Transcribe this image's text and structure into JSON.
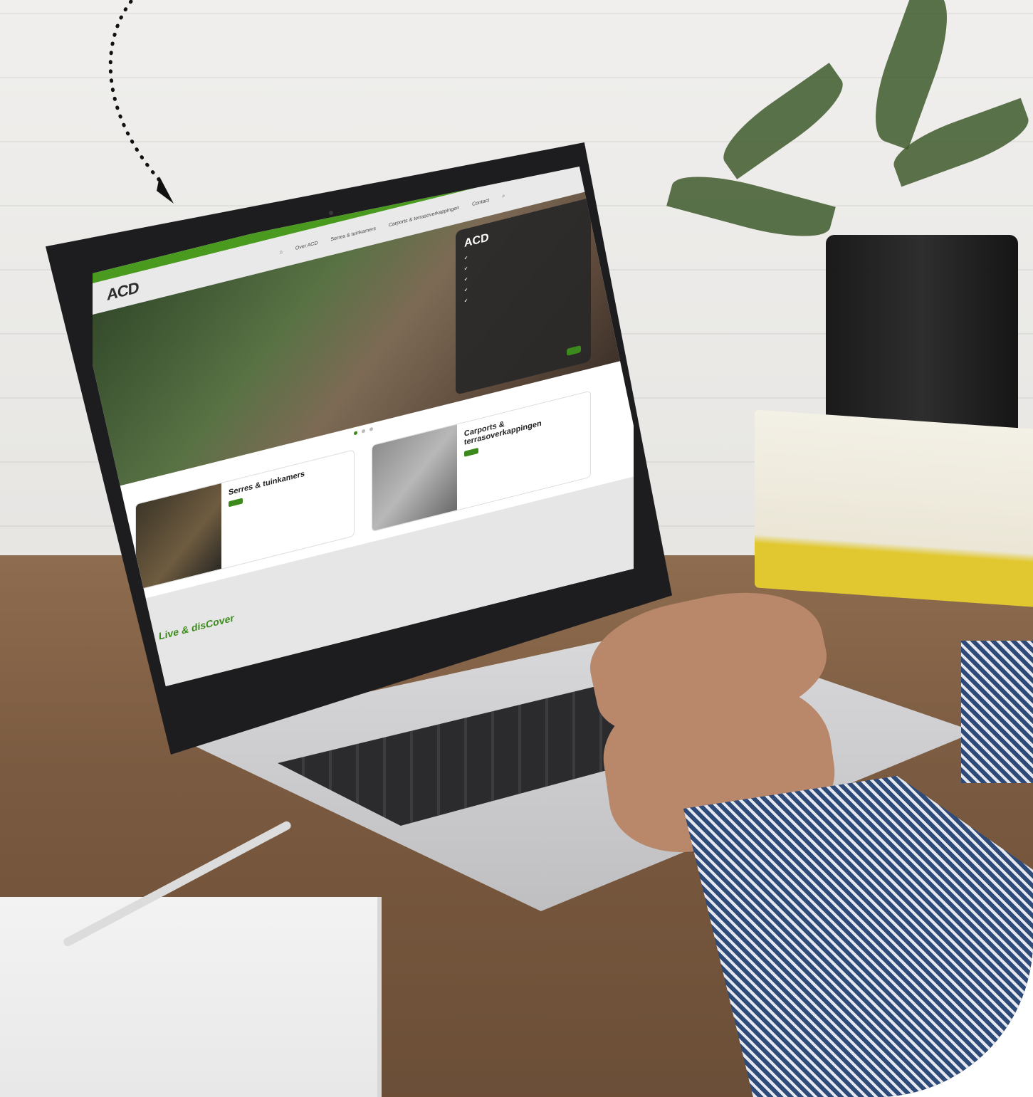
{
  "site": {
    "topbar_links": [
      "",
      ""
    ],
    "logo": "ACD",
    "nav_items": [
      "Over ACD",
      "Serres & tuinkamers",
      "Carports & terrasoverkappingen",
      "Contact"
    ],
    "hero_panel": {
      "logo": "ACD",
      "cta": ""
    },
    "cards": [
      {
        "title": "Serres & tuinkamers",
        "button": ""
      },
      {
        "title": "Carports & terrasoverkappingen",
        "button": ""
      }
    ],
    "tagline": "Grow, Live & disCover",
    "subline": "",
    "cookie": ""
  },
  "colors": {
    "brand_green": "#3c8a1c",
    "topbar_green": "#4a9a1f"
  }
}
